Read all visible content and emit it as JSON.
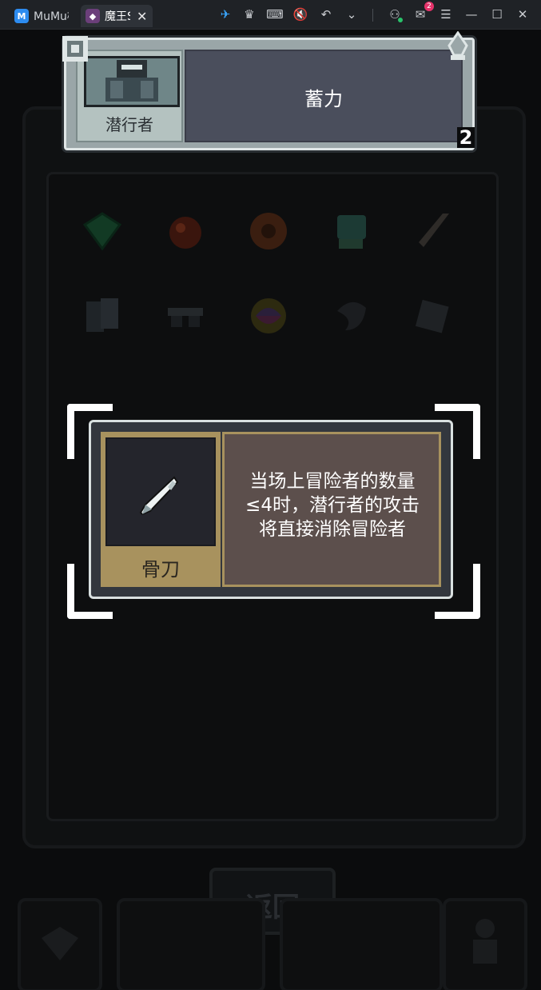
{
  "window": {
    "tabs": [
      {
        "label": "MuMu模",
        "icon": "mumu-logo-icon"
      },
      {
        "label": "魔王S",
        "icon": "game-tab-icon"
      }
    ],
    "toolbar_icons": [
      "pin-icon",
      "crown-icon",
      "keyboard-icon",
      "mute-icon",
      "undo-icon",
      "chevron-down-icon",
      "user-icon",
      "mail-icon",
      "menu-icon",
      "minimize-icon",
      "maximize-icon",
      "close-icon"
    ],
    "mail_badge": "2"
  },
  "character_card": {
    "name": "潜行者",
    "skill": "蓄力",
    "corner_number": "2"
  },
  "tooltip": {
    "item_name": "骨刀",
    "description_lines": [
      "当场上冒险者的数量",
      "≤4时，潜行者的攻击",
      "将直接消除冒险者"
    ]
  },
  "background": {
    "back_button": "返回",
    "item_icons": [
      "green-gem-icon",
      "red-orb-icon",
      "eye-orb-icon",
      "green-gauntlet-icon",
      "bone-knife-icon",
      "card-deck-icon",
      "glasses-icon",
      "swirl-icon",
      "crow-icon",
      "dice-icon"
    ]
  },
  "colors": {
    "card_bg": "#9aa6a8",
    "skill_bg": "#4a4e5c",
    "tooltip_gold": "#a8925e",
    "tooltip_desc_bg": "#5c4f4c",
    "badge": "#e5336b"
  }
}
